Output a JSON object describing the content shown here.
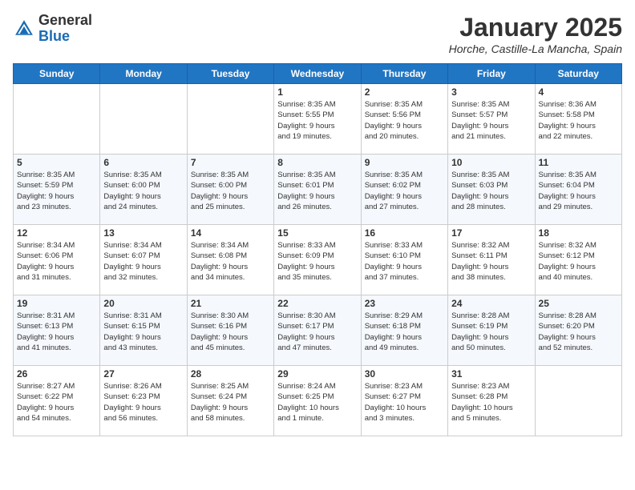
{
  "header": {
    "logo_general": "General",
    "logo_blue": "Blue",
    "month_title": "January 2025",
    "location": "Horche, Castille-La Mancha, Spain"
  },
  "weekdays": [
    "Sunday",
    "Monday",
    "Tuesday",
    "Wednesday",
    "Thursday",
    "Friday",
    "Saturday"
  ],
  "weeks": [
    [
      {
        "day": "",
        "info": ""
      },
      {
        "day": "",
        "info": ""
      },
      {
        "day": "",
        "info": ""
      },
      {
        "day": "1",
        "info": "Sunrise: 8:35 AM\nSunset: 5:55 PM\nDaylight: 9 hours\nand 19 minutes."
      },
      {
        "day": "2",
        "info": "Sunrise: 8:35 AM\nSunset: 5:56 PM\nDaylight: 9 hours\nand 20 minutes."
      },
      {
        "day": "3",
        "info": "Sunrise: 8:35 AM\nSunset: 5:57 PM\nDaylight: 9 hours\nand 21 minutes."
      },
      {
        "day": "4",
        "info": "Sunrise: 8:36 AM\nSunset: 5:58 PM\nDaylight: 9 hours\nand 22 minutes."
      }
    ],
    [
      {
        "day": "5",
        "info": "Sunrise: 8:35 AM\nSunset: 5:59 PM\nDaylight: 9 hours\nand 23 minutes."
      },
      {
        "day": "6",
        "info": "Sunrise: 8:35 AM\nSunset: 6:00 PM\nDaylight: 9 hours\nand 24 minutes."
      },
      {
        "day": "7",
        "info": "Sunrise: 8:35 AM\nSunset: 6:00 PM\nDaylight: 9 hours\nand 25 minutes."
      },
      {
        "day": "8",
        "info": "Sunrise: 8:35 AM\nSunset: 6:01 PM\nDaylight: 9 hours\nand 26 minutes."
      },
      {
        "day": "9",
        "info": "Sunrise: 8:35 AM\nSunset: 6:02 PM\nDaylight: 9 hours\nand 27 minutes."
      },
      {
        "day": "10",
        "info": "Sunrise: 8:35 AM\nSunset: 6:03 PM\nDaylight: 9 hours\nand 28 minutes."
      },
      {
        "day": "11",
        "info": "Sunrise: 8:35 AM\nSunset: 6:04 PM\nDaylight: 9 hours\nand 29 minutes."
      }
    ],
    [
      {
        "day": "12",
        "info": "Sunrise: 8:34 AM\nSunset: 6:06 PM\nDaylight: 9 hours\nand 31 minutes."
      },
      {
        "day": "13",
        "info": "Sunrise: 8:34 AM\nSunset: 6:07 PM\nDaylight: 9 hours\nand 32 minutes."
      },
      {
        "day": "14",
        "info": "Sunrise: 8:34 AM\nSunset: 6:08 PM\nDaylight: 9 hours\nand 34 minutes."
      },
      {
        "day": "15",
        "info": "Sunrise: 8:33 AM\nSunset: 6:09 PM\nDaylight: 9 hours\nand 35 minutes."
      },
      {
        "day": "16",
        "info": "Sunrise: 8:33 AM\nSunset: 6:10 PM\nDaylight: 9 hours\nand 37 minutes."
      },
      {
        "day": "17",
        "info": "Sunrise: 8:32 AM\nSunset: 6:11 PM\nDaylight: 9 hours\nand 38 minutes."
      },
      {
        "day": "18",
        "info": "Sunrise: 8:32 AM\nSunset: 6:12 PM\nDaylight: 9 hours\nand 40 minutes."
      }
    ],
    [
      {
        "day": "19",
        "info": "Sunrise: 8:31 AM\nSunset: 6:13 PM\nDaylight: 9 hours\nand 41 minutes."
      },
      {
        "day": "20",
        "info": "Sunrise: 8:31 AM\nSunset: 6:15 PM\nDaylight: 9 hours\nand 43 minutes."
      },
      {
        "day": "21",
        "info": "Sunrise: 8:30 AM\nSunset: 6:16 PM\nDaylight: 9 hours\nand 45 minutes."
      },
      {
        "day": "22",
        "info": "Sunrise: 8:30 AM\nSunset: 6:17 PM\nDaylight: 9 hours\nand 47 minutes."
      },
      {
        "day": "23",
        "info": "Sunrise: 8:29 AM\nSunset: 6:18 PM\nDaylight: 9 hours\nand 49 minutes."
      },
      {
        "day": "24",
        "info": "Sunrise: 8:28 AM\nSunset: 6:19 PM\nDaylight: 9 hours\nand 50 minutes."
      },
      {
        "day": "25",
        "info": "Sunrise: 8:28 AM\nSunset: 6:20 PM\nDaylight: 9 hours\nand 52 minutes."
      }
    ],
    [
      {
        "day": "26",
        "info": "Sunrise: 8:27 AM\nSunset: 6:22 PM\nDaylight: 9 hours\nand 54 minutes."
      },
      {
        "day": "27",
        "info": "Sunrise: 8:26 AM\nSunset: 6:23 PM\nDaylight: 9 hours\nand 56 minutes."
      },
      {
        "day": "28",
        "info": "Sunrise: 8:25 AM\nSunset: 6:24 PM\nDaylight: 9 hours\nand 58 minutes."
      },
      {
        "day": "29",
        "info": "Sunrise: 8:24 AM\nSunset: 6:25 PM\nDaylight: 10 hours\nand 1 minute."
      },
      {
        "day": "30",
        "info": "Sunrise: 8:23 AM\nSunset: 6:27 PM\nDaylight: 10 hours\nand 3 minutes."
      },
      {
        "day": "31",
        "info": "Sunrise: 8:23 AM\nSunset: 6:28 PM\nDaylight: 10 hours\nand 5 minutes."
      },
      {
        "day": "",
        "info": ""
      }
    ]
  ]
}
